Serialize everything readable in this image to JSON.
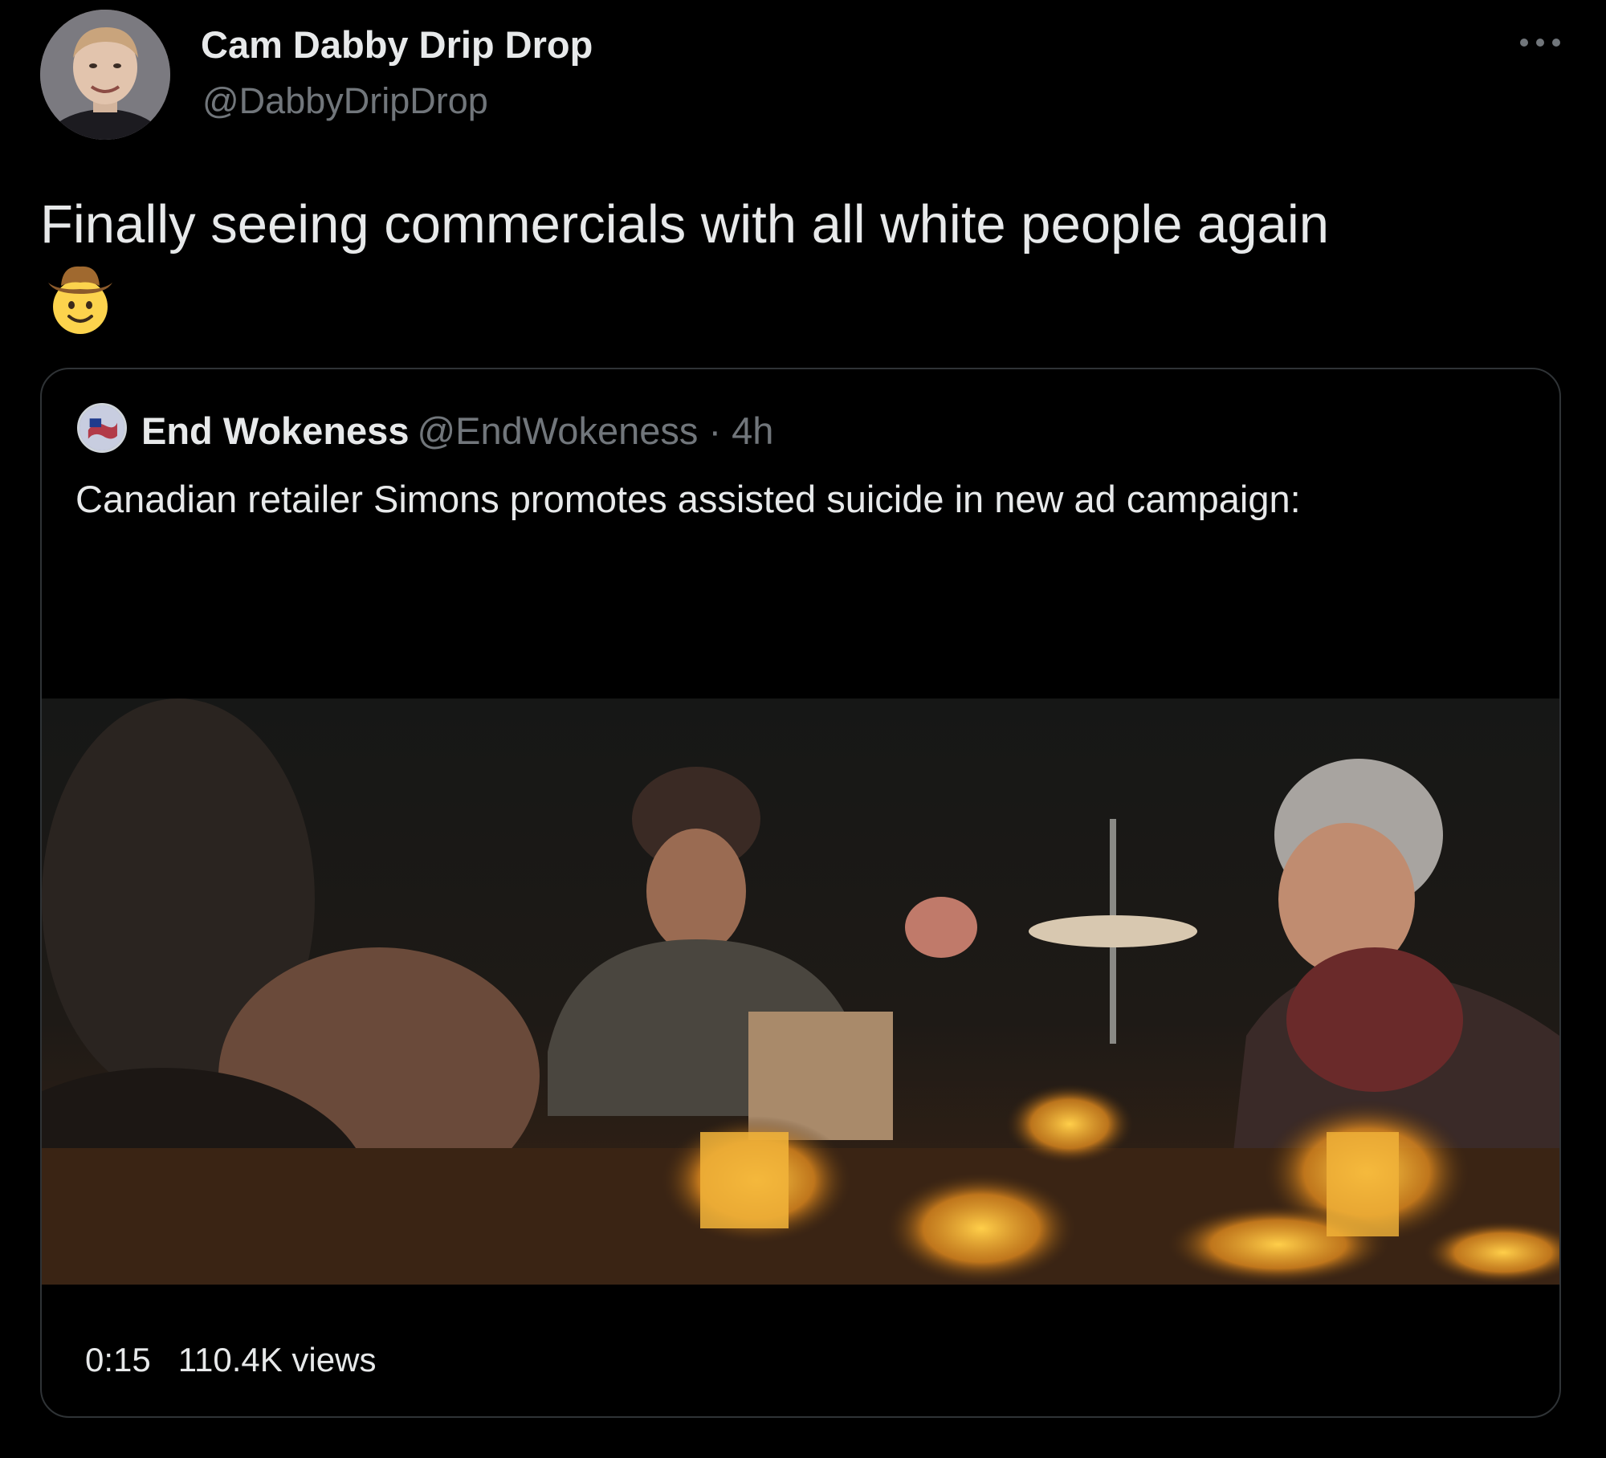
{
  "tweet": {
    "author": {
      "display_name": "Cam Dabby Drip Drop",
      "handle": "@DabbyDripDrop",
      "avatar_icon": "profile-photo"
    },
    "text": "Finally seeing commercials with all white people again",
    "emoji": "cowboy-hat-face-emoji",
    "more_icon": "more-options-icon"
  },
  "quote": {
    "author": {
      "display_name": "End Wokeness",
      "handle": "@EndWokeness",
      "separator": "·",
      "time": "4h"
    },
    "text": "Canadian retailer Simons promotes assisted suicide in new ad campaign:",
    "video": {
      "duration": "0:15",
      "views": "110.4K views"
    }
  },
  "colors": {
    "background": "#000000",
    "primary_text": "#e7e9ea",
    "secondary_text": "#71767b",
    "border": "#2f3336"
  }
}
